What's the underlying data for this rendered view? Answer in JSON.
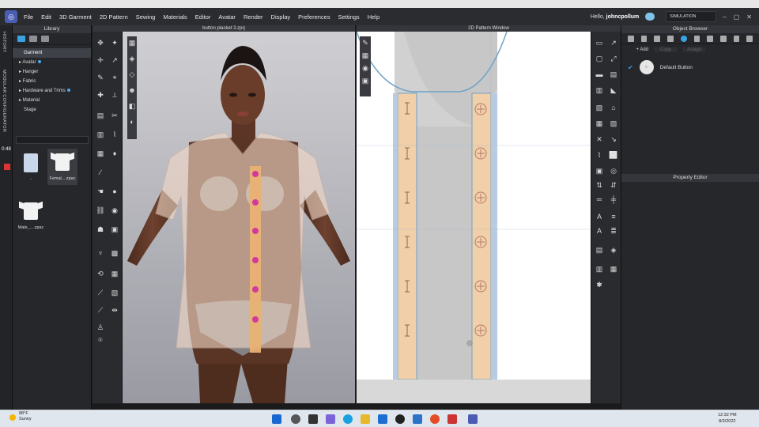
{
  "app": {
    "menu": [
      "File",
      "Edit",
      "3D Garment",
      "2D Pattern",
      "Sewing",
      "Materials",
      "Editor",
      "Avatar",
      "Render",
      "Display",
      "Preferences",
      "Settings",
      "Help"
    ],
    "greeting_prefix": "Hello,",
    "username": "johncpollum",
    "mode_label": "SIMULATION",
    "window_controls": [
      "–",
      "▢",
      "✕"
    ]
  },
  "left_tabs": [
    "HISTORY",
    "MODULAR CONFIGURATOR"
  ],
  "timer": "0:48",
  "library": {
    "title": "Library",
    "tree": [
      {
        "label": "Garment",
        "selected": true
      },
      {
        "label": "Avatar",
        "info": true
      },
      {
        "label": "Hanger"
      },
      {
        "label": "Fabric"
      },
      {
        "label": "Hardware and Trims",
        "info": true
      },
      {
        "label": "Material"
      },
      {
        "label": "Stage"
      }
    ],
    "thumbs": [
      {
        "label": ".."
      },
      {
        "label": "Femal....zpac"
      },
      {
        "label": "Male_....zpac"
      }
    ]
  },
  "view3d": {
    "title": "button placket 3.zprj"
  },
  "view2d": {
    "title": "2D Pattern Window"
  },
  "object_browser": {
    "title": "Object Browser",
    "add_label": "+ Add",
    "copy_label": "Copy",
    "assign_label": "Assign",
    "item_label": "Default Button"
  },
  "property_editor": {
    "title": "Property Editor"
  },
  "taskbar": {
    "temp": "88°F",
    "condition": "Sunny",
    "time": "12:32 PM",
    "date": "8/3/2022"
  }
}
